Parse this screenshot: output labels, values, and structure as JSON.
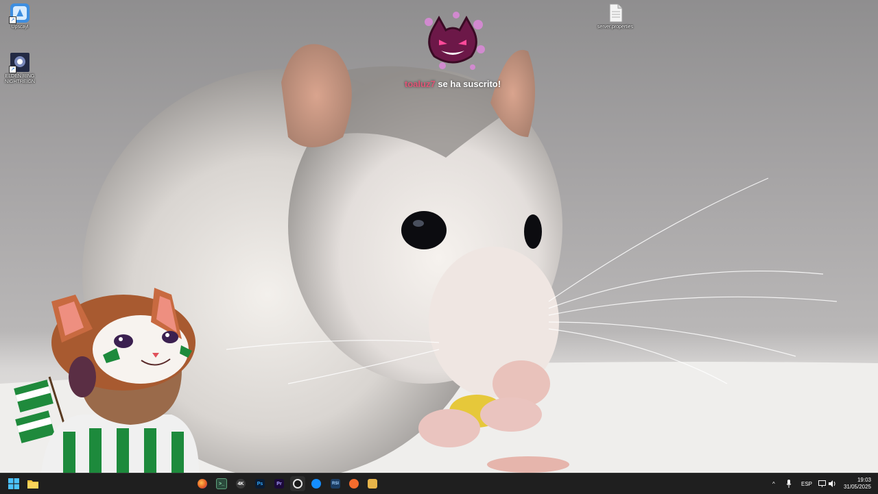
{
  "desktop": {
    "icons": [
      {
        "label": "Upscayl",
        "icon": "upscayl-icon"
      },
      {
        "label": "ELDEN RING NIGHTREIGN",
        "icon": "elden-ring-icon"
      },
      {
        "label": "server.properties",
        "icon": "document-icon"
      }
    ]
  },
  "alert": {
    "user": "toaluz7",
    "message": " se ha suscrito!",
    "user_color": "#e05576",
    "icon": "demon-cat-icon"
  },
  "taskbar": {
    "apps": [
      {
        "name": "start-button",
        "icon": "windows-logo-icon"
      },
      {
        "name": "file-explorer",
        "icon": "folder-icon"
      },
      {
        "name": "firefox",
        "icon": "firefox-icon"
      },
      {
        "name": "terminal",
        "icon": "terminal-icon"
      },
      {
        "name": "video-4k",
        "icon": "4k-icon",
        "text": "4K"
      },
      {
        "name": "photoshop",
        "icon": "photoshop-icon",
        "text": "Ps"
      },
      {
        "name": "premiere",
        "icon": "premiere-icon",
        "text": "Pr"
      },
      {
        "name": "obs",
        "icon": "obs-icon"
      },
      {
        "name": "battle-net",
        "icon": "battlenet-icon"
      },
      {
        "name": "rsi-launcher",
        "icon": "rsi-icon",
        "text": "RSI"
      },
      {
        "name": "origin",
        "icon": "origin-icon"
      },
      {
        "name": "package-app",
        "icon": "box-icon"
      }
    ],
    "tray": {
      "language": "ESP",
      "time": "19:03",
      "date": "31/05/2025"
    }
  }
}
